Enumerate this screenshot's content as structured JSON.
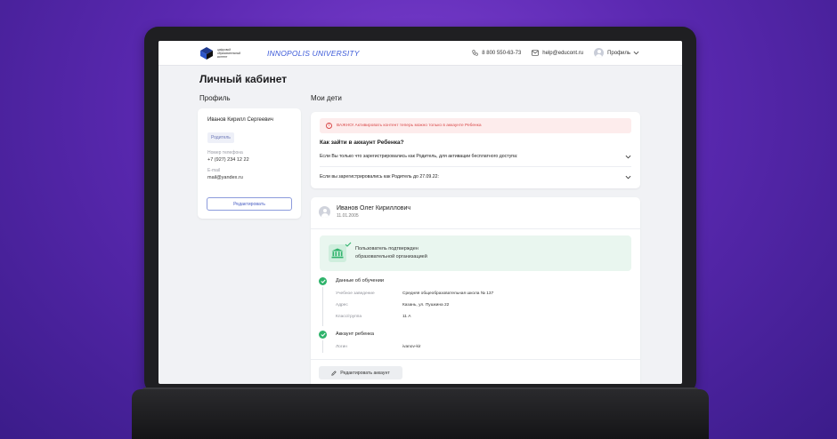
{
  "header": {
    "logo_text": "цифровой образовательный контент",
    "university_logo": "INNOPOLIS UNIVERSITY",
    "phone": "8 800 550-63-73",
    "email": "help@educont.ru",
    "profile_label": "Профиль"
  },
  "page": {
    "title": "Личный кабинет",
    "profile_section_title": "Профиль",
    "children_section_title": "Мои дети"
  },
  "profile": {
    "name": "Иванов Кирилл Сергеевич",
    "role": "Родитель",
    "phone_label": "Номер телефона",
    "phone": "+7 (927) 234 12 22",
    "email_label": "E-mail",
    "email": "mail@yandex.ru",
    "edit_button": "Редактировать"
  },
  "info": {
    "alert": "ВАЖНО! Активировать контент теперь можно только в аккаунте Ребенка",
    "how_title": "Как зайти в аккаунт Ребенка?",
    "accordion": [
      "Если Вы только что зарегистрировались как Родитель, для активации бесплатного доступа:",
      "Если вы зарегистрировались как Родитель до 27.09.22:"
    ]
  },
  "child": {
    "name": "Иванов Олег Кириллович",
    "birth_date": "11.01.2005",
    "verified_line1": "Пользователь подтвержден",
    "verified_line2": "образовательной организацией",
    "education": {
      "title": "Данные об обучении",
      "school_label": "Учебное заведение",
      "school": "Средняя общеобразовательная школа № 137",
      "address_label": "Адрес",
      "address": "Казань, ул. Пушкина 22",
      "class_label": "Класс/группа",
      "class": "11 А"
    },
    "account": {
      "title": "Аккаунт ребенка",
      "login_label": "Логин",
      "login": "ivanov-kir"
    },
    "edit_account_button": "Редактировать аккаунт"
  },
  "colors": {
    "accent": "#4a5fc4",
    "alert": "#d94b4b",
    "success": "#2fb36b",
    "background": "#5a28b0"
  }
}
